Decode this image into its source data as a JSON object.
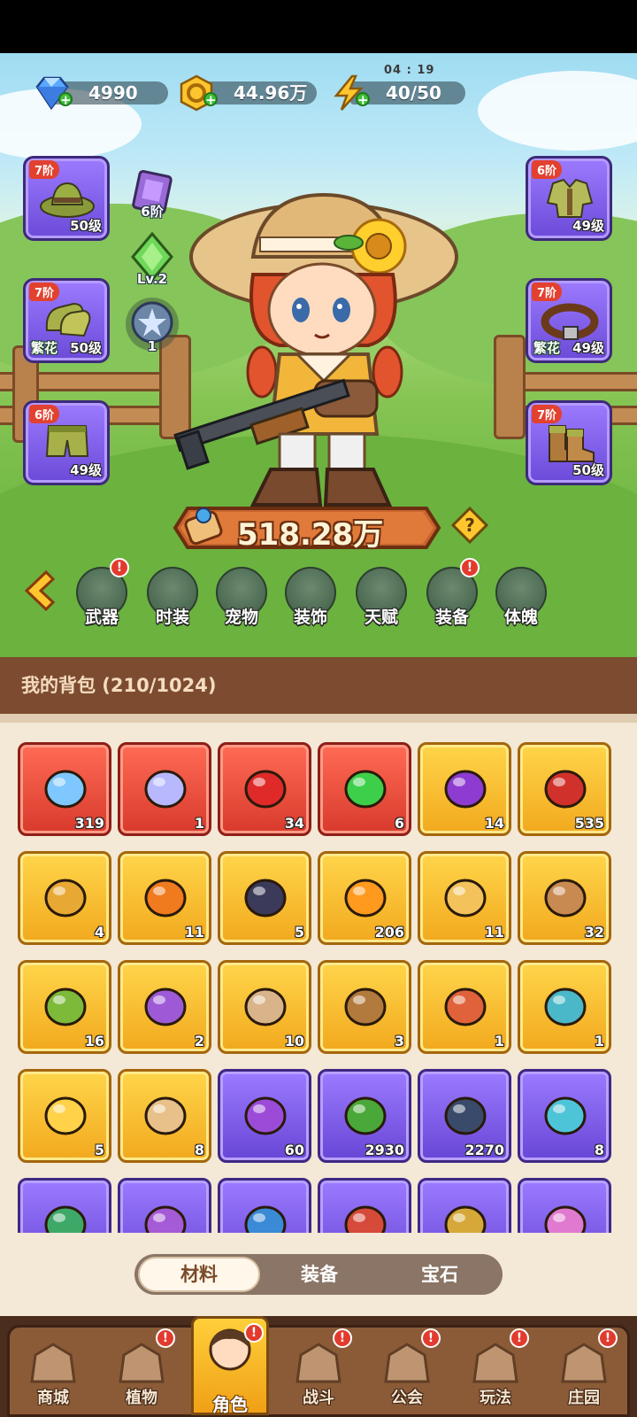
{
  "resources": {
    "gems": "4990",
    "gold": "44.96万",
    "energy": "40/50",
    "energy_timer": "04 : 19"
  },
  "equipment_left": [
    {
      "tier": "7阶",
      "level": "50级",
      "tag": ""
    },
    {
      "tier": "7阶",
      "level": "50级",
      "tag": "繁花"
    },
    {
      "tier": "6阶",
      "level": "49级",
      "tag": ""
    }
  ],
  "equipment_right": [
    {
      "tier": "6阶",
      "level": "49级",
      "tag": ""
    },
    {
      "tier": "7阶",
      "level": "49级",
      "tag": "繁花"
    },
    {
      "tier": "7阶",
      "level": "50级",
      "tag": ""
    }
  ],
  "mini_stats": {
    "book_tier": "6阶",
    "crystal_level": "Lv.2",
    "orb_count": "1"
  },
  "power": "518.28万",
  "menu": [
    {
      "label": "武器",
      "badge": "!"
    },
    {
      "label": "时装",
      "badge": ""
    },
    {
      "label": "宠物",
      "badge": ""
    },
    {
      "label": "装饰",
      "badge": ""
    },
    {
      "label": "天赋",
      "badge": ""
    },
    {
      "label": "装备",
      "badge": "!"
    },
    {
      "label": "体魄",
      "badge": ""
    }
  ],
  "backpack": {
    "title": "我的背包 (210/1024)",
    "items": [
      {
        "count": "319",
        "rarity": "red",
        "icon": "star-crystal-icon",
        "color": "#7fc7ff"
      },
      {
        "count": "1",
        "rarity": "red",
        "icon": "moon-crystal-icon",
        "color": "#b8b8ff"
      },
      {
        "count": "34",
        "rarity": "red",
        "icon": "red-potion-icon",
        "color": "#e02a2a"
      },
      {
        "count": "6",
        "rarity": "red",
        "icon": "green-canister-icon",
        "color": "#3ecf4a"
      },
      {
        "count": "14",
        "rarity": "gold",
        "icon": "skull-scroll-icon",
        "color": "#8e3bd1"
      },
      {
        "count": "535",
        "rarity": "gold",
        "icon": "ladybug-icon",
        "color": "#d0322b"
      },
      {
        "count": "4",
        "rarity": "gold",
        "icon": "key-icon",
        "color": "#e8a834"
      },
      {
        "count": "11",
        "rarity": "gold",
        "icon": "fire-pyramid-icon",
        "color": "#f07a1e"
      },
      {
        "count": "5",
        "rarity": "gold",
        "icon": "rune-stone-icon",
        "color": "#3b3a5a"
      },
      {
        "count": "206",
        "rarity": "gold",
        "icon": "orange-potion-icon",
        "color": "#ff9a1e"
      },
      {
        "count": "11",
        "rarity": "gold",
        "icon": "sand-pile-icon",
        "color": "#f3c25a"
      },
      {
        "count": "32",
        "rarity": "gold",
        "icon": "flower-pot-icon",
        "color": "#c98a52"
      },
      {
        "count": "16",
        "rarity": "gold",
        "icon": "sprayer-icon",
        "color": "#7dba3a"
      },
      {
        "count": "2",
        "rarity": "gold",
        "icon": "spell-book-icon",
        "color": "#9e5ad6"
      },
      {
        "count": "10",
        "rarity": "gold",
        "icon": "canned-food-icon",
        "color": "#d9b48a"
      },
      {
        "count": "3",
        "rarity": "gold",
        "icon": "owl-icon",
        "color": "#b37a3d"
      },
      {
        "count": "1",
        "rarity": "gold",
        "icon": "ruby-ore-icon",
        "color": "#e0623a"
      },
      {
        "count": "1",
        "rarity": "gold",
        "icon": "tablet-icon",
        "color": "#4ab8c8"
      },
      {
        "count": "5",
        "rarity": "gold",
        "icon": "golden-flower-icon",
        "color": "#ffd24a"
      },
      {
        "count": "8",
        "rarity": "gold",
        "icon": "knot-emblem-icon",
        "color": "#e8c08a"
      },
      {
        "count": "60",
        "rarity": "purple",
        "icon": "purple-potion-icon",
        "color": "#9b4bd8"
      },
      {
        "count": "2930",
        "rarity": "purple",
        "icon": "sprout-icon",
        "color": "#4aa83a"
      },
      {
        "count": "2270",
        "rarity": "purple",
        "icon": "energy-token-icon",
        "color": "#3a4a6a"
      },
      {
        "count": "8",
        "rarity": "purple",
        "icon": "feather-leaf-icon",
        "color": "#4ec4d8"
      },
      {
        "count": "",
        "rarity": "purple",
        "icon": "green-scroll-icon",
        "color": "#3ea868"
      },
      {
        "count": "",
        "rarity": "purple",
        "icon": "purple-scroll-icon",
        "color": "#a55ad6"
      },
      {
        "count": "",
        "rarity": "purple",
        "icon": "blue-scroll-icon",
        "color": "#3a8ad6"
      },
      {
        "count": "",
        "rarity": "purple",
        "icon": "red-scroll-icon",
        "color": "#d64a3a"
      },
      {
        "count": "",
        "rarity": "purple",
        "icon": "gold-scroll-icon",
        "color": "#d6a83a"
      },
      {
        "count": "",
        "rarity": "purple",
        "icon": "pink-potion-icon",
        "color": "#e07ad0"
      }
    ]
  },
  "tabs": [
    {
      "label": "材料",
      "active": true
    },
    {
      "label": "装备",
      "active": false
    },
    {
      "label": "宝石",
      "active": false
    }
  ],
  "nav": [
    {
      "label": "商城",
      "badge": ""
    },
    {
      "label": "植物",
      "badge": "!"
    },
    {
      "label": "角色",
      "badge": "!",
      "active": true
    },
    {
      "label": "战斗",
      "badge": "!"
    },
    {
      "label": "公会",
      "badge": "!"
    },
    {
      "label": "玩法",
      "badge": "!"
    },
    {
      "label": "庄园",
      "badge": "!"
    }
  ]
}
